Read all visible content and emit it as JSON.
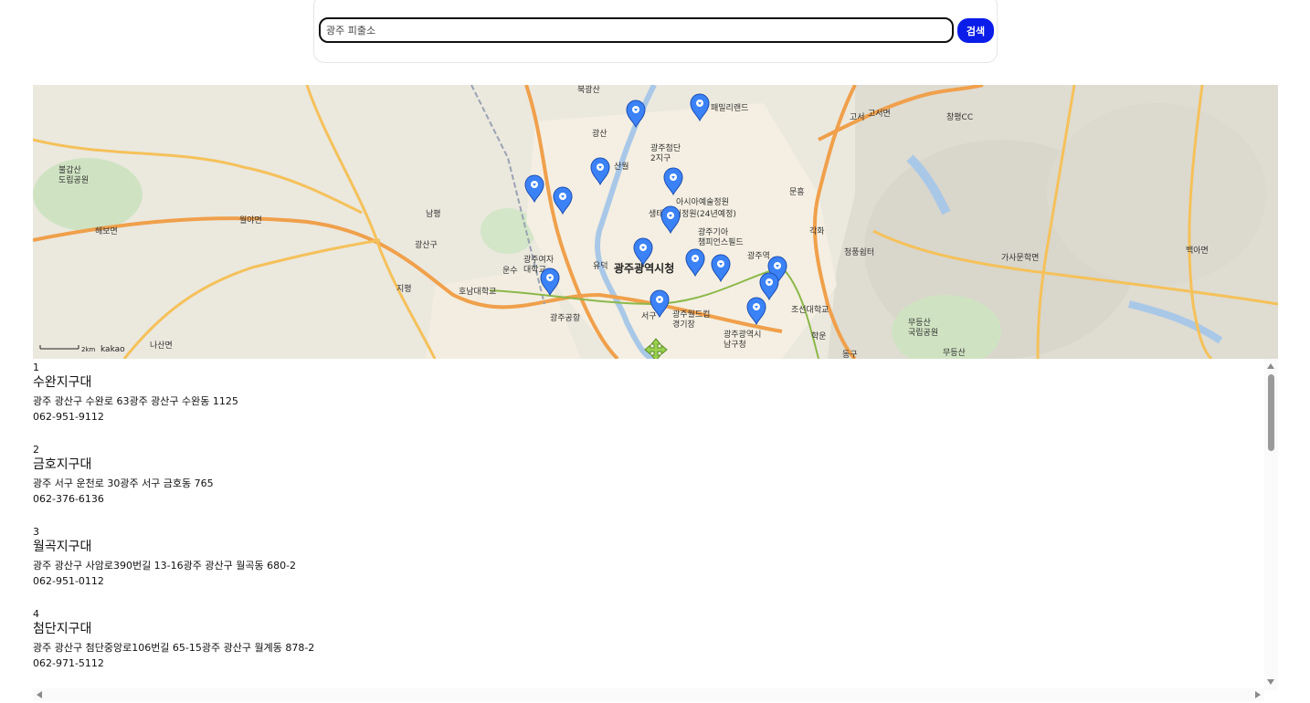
{
  "search": {
    "value": "",
    "placeholder": "광주 피출소",
    "button_label": "검색"
  },
  "map": {
    "city_hall_label": "광주광역시청",
    "labels": [
      "불갑산\n도립공원",
      "해보면",
      "월야면",
      "광산구",
      "남평",
      "지평",
      "나산면",
      "광주공항",
      "광주여자\n대학교",
      "운수",
      "호남대학교",
      "유덕",
      "아시아예술정원",
      "생태 놀이정원(24년예정)",
      "광주기아\n챔피언스필드",
      "광주역",
      "서구",
      "광주월드컵\n경기장",
      "광주광역시\n남구청",
      "조선대학교",
      "학운",
      "동구",
      "청풍쉼터",
      "가사문학면",
      "무등산\n국립공원",
      "무등산",
      "백아면",
      "고서",
      "고서면",
      "창평CC",
      "북광산",
      "패밀리랜드",
      "광산",
      "산월",
      "광주첨단\n2지구",
      "문흥",
      "각화"
    ],
    "scale_label": "2km",
    "brand_label": "kakao",
    "marker_icon": "map-pin-icon",
    "accent_color": "#3b82f6"
  },
  "results": [
    {
      "index": "1",
      "name": "수완지구대",
      "address": "광주 광산구 수완로 63광주 광산구 수완동 1125",
      "phone": "062-951-9112"
    },
    {
      "index": "2",
      "name": "금호지구대",
      "address": "광주 서구 운천로 30광주 서구 금호동 765",
      "phone": "062-376-6136"
    },
    {
      "index": "3",
      "name": "월곡지구대",
      "address": "광주 광산구 사암로390번길 13-16광주 광산구 월곡동 680-2",
      "phone": "062-951-0112"
    },
    {
      "index": "4",
      "name": "첨단지구대",
      "address": "광주 광산구 첨단중앙로106번길 65-15광주 광산구 월계동 878-2",
      "phone": "062-971-5112"
    }
  ]
}
